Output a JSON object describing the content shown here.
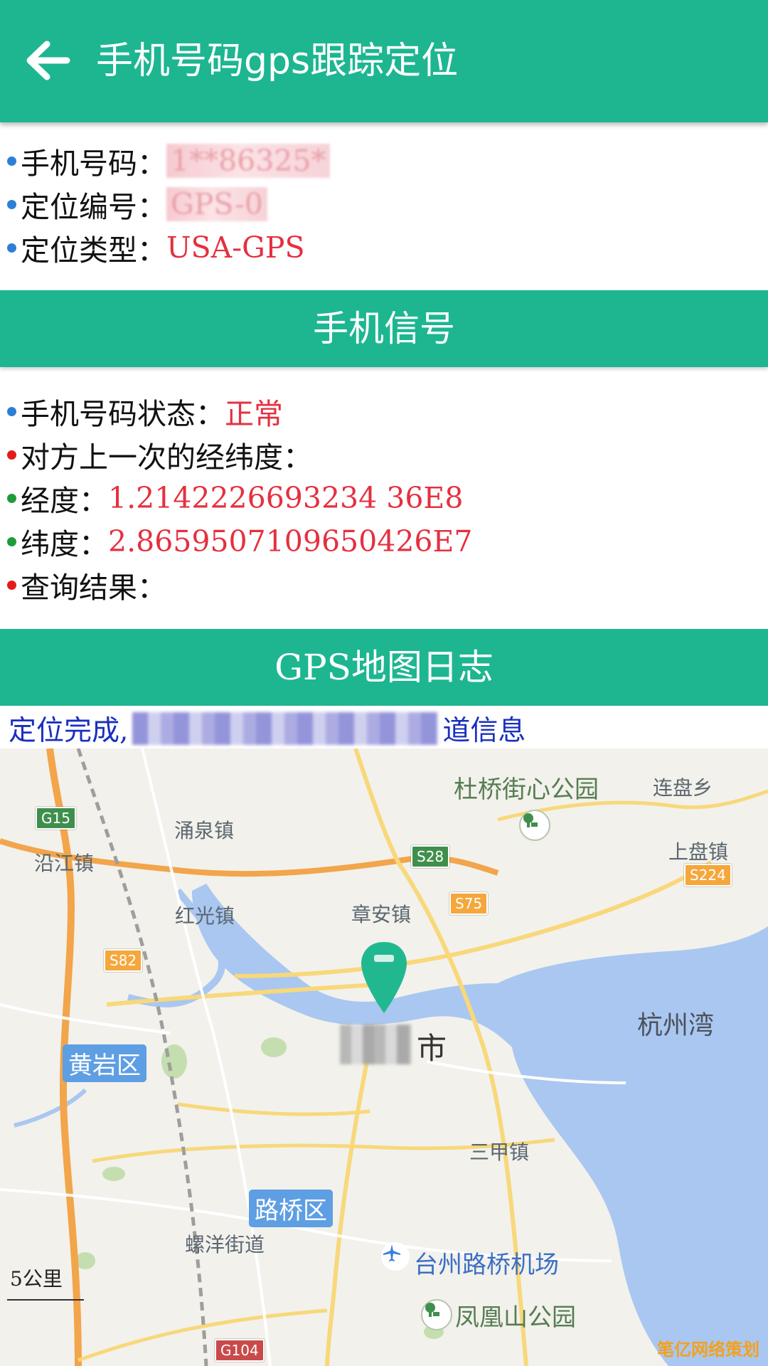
{
  "app_bar": {
    "back_icon": "arrow-left-icon",
    "title": "手机号码gps跟踪定位"
  },
  "phone_info": {
    "phone_label": "手机号码：",
    "phone_value": "1**86325*",
    "locate_id_label": "定位编号：",
    "locate_id_value": "GPS-0",
    "locate_type_label": "定位类型：",
    "locate_type_value": "USA-GPS"
  },
  "signal_section": {
    "header": "手机信号",
    "status_label": "手机号码状态：",
    "status_value": "正常",
    "last_coord_label": "对方上一次的经纬度：",
    "longitude_label": "经度：",
    "longitude_value": "1.2142226693234 36E8",
    "latitude_label": "纬度：",
    "latitude_value": "2.8659507109650426E7",
    "result_label": "查询结果："
  },
  "map_section": {
    "header": "GPS地图日志",
    "status_prefix": "定位完成,",
    "status_suffix": "道信息"
  },
  "map": {
    "labels": {
      "duqiao_park": "杜桥街心公园",
      "lianpan": "连盘乡",
      "yongquan": "涌泉镇",
      "shangpan": "上盘镇",
      "yanjiang": "沿江镇",
      "hongguang": "红光镇",
      "zhangan": "章安镇",
      "hangzhou_bay": "杭州湾",
      "city_suffix": "市",
      "sanjia": "三甲镇",
      "luoyang": "螺洋街道",
      "airport": "台州路桥机场",
      "fenghuang": "凤凰山公园"
    },
    "districts": {
      "huangyan": "黄岩区",
      "luqiao": "路桥区"
    },
    "shields": {
      "g15": "G15",
      "s28": "S28",
      "s224": "S224",
      "s75": "S75",
      "s82": "S82",
      "g104": "G104"
    },
    "scale": "5公里",
    "pin_icon": "location-pin-icon",
    "park_icon": "park-icon",
    "airport_icon": "airplane-icon"
  },
  "watermark": "笔亿网络策划",
  "colors": {
    "primary": "#1db691",
    "value_red": "#e53040",
    "link_blue": "#1a2fbf",
    "water": "#a9c7f0"
  }
}
